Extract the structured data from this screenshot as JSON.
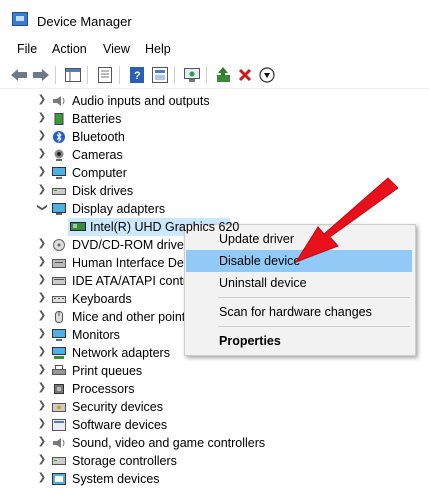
{
  "window": {
    "title": "Device Manager"
  },
  "menu": [
    "File",
    "Action",
    "View",
    "Help"
  ],
  "toolbar": [
    "back-icon",
    "forward-icon",
    "properties-pane-icon",
    "device-list-icon",
    "help-icon",
    "view-icon",
    "scan-icon",
    "update-driver-icon",
    "uninstall-icon",
    "disable-icon"
  ],
  "tree": {
    "items": [
      {
        "label": "Audio inputs and outputs",
        "icon": "speaker-icon",
        "expanded": false
      },
      {
        "label": "Batteries",
        "icon": "battery-icon",
        "expanded": false
      },
      {
        "label": "Bluetooth",
        "icon": "bluetooth-icon",
        "expanded": false
      },
      {
        "label": "Cameras",
        "icon": "camera-icon",
        "expanded": false
      },
      {
        "label": "Computer",
        "icon": "computer-icon",
        "expanded": false
      },
      {
        "label": "Disk drives",
        "icon": "disk-icon",
        "expanded": false
      },
      {
        "label": "Display adapters",
        "icon": "display-icon",
        "expanded": true
      },
      {
        "label": "Intel(R) UHD Graphics 620",
        "icon": "display-adapter-icon",
        "child": true
      },
      {
        "label": "DVD/CD-ROM drives",
        "icon": "dvd-icon",
        "expanded": false
      },
      {
        "label": "Human Interface Devices",
        "icon": "hid-icon",
        "expanded": false
      },
      {
        "label": "IDE ATA/ATAPI controllers",
        "icon": "ide-icon",
        "expanded": false
      },
      {
        "label": "Keyboards",
        "icon": "keyboard-icon",
        "expanded": false
      },
      {
        "label": "Mice and other pointing devices",
        "icon": "mouse-icon",
        "expanded": false
      },
      {
        "label": "Monitors",
        "icon": "monitor-icon",
        "expanded": false
      },
      {
        "label": "Network adapters",
        "icon": "network-icon",
        "expanded": false
      },
      {
        "label": "Print queues",
        "icon": "printer-icon",
        "expanded": false
      },
      {
        "label": "Processors",
        "icon": "processor-icon",
        "expanded": false
      },
      {
        "label": "Security devices",
        "icon": "security-icon",
        "expanded": false
      },
      {
        "label": "Software devices",
        "icon": "software-icon",
        "expanded": false
      },
      {
        "label": "Sound, video and game controllers",
        "icon": "sound-icon",
        "expanded": false
      },
      {
        "label": "Storage controllers",
        "icon": "storage-icon",
        "expanded": false
      },
      {
        "label": "System devices",
        "icon": "system-icon",
        "expanded": false
      }
    ]
  },
  "context_menu": {
    "items": [
      {
        "label": "Update driver"
      },
      {
        "label": "Disable device",
        "highlighted": true
      },
      {
        "label": "Uninstall device"
      },
      {
        "label": "Scan for hardware changes"
      },
      {
        "label": "Properties",
        "bold": true
      }
    ]
  },
  "colors": {
    "accent_arrow": "#e8101a",
    "selection": "#cce8ff",
    "menu_hover": "#91c9f7"
  }
}
